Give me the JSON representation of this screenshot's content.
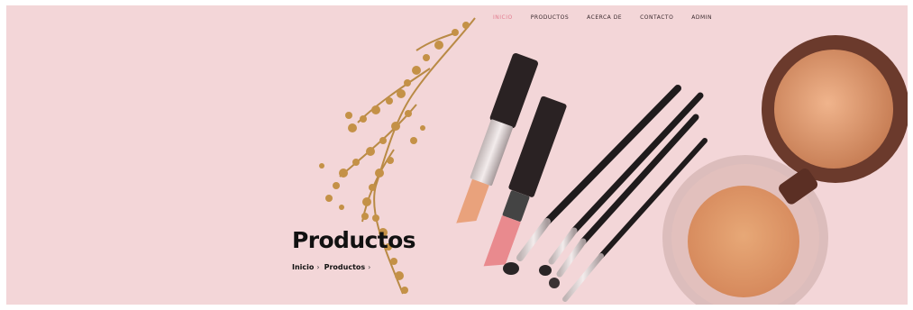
{
  "nav": {
    "items": [
      {
        "label": "INICIO",
        "active": true
      },
      {
        "label": "PRODUCTOS",
        "active": false
      },
      {
        "label": "ACERCA DE",
        "active": false
      },
      {
        "label": "CONTACTO",
        "active": false
      },
      {
        "label": "ADMIN",
        "active": false
      }
    ]
  },
  "hero": {
    "title": "Productos",
    "breadcrumb": [
      {
        "label": "Inicio"
      },
      {
        "label": "Productos"
      }
    ],
    "separator": "›"
  },
  "colors": {
    "background": "#f3d6d8",
    "nav_active": "#e37c8f",
    "nav_text": "#3a2a2e",
    "title": "#111111"
  }
}
